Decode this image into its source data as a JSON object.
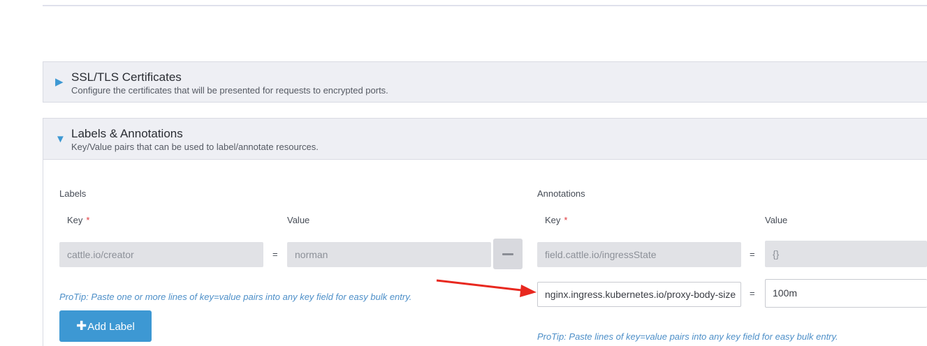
{
  "ssl": {
    "title": "SSL/TLS Certificates",
    "description": "Configure the certificates that will be presented for requests to encrypted ports."
  },
  "labels_section": {
    "title": "Labels & Annotations",
    "description": "Key/Value pairs that can be used to label/annotate resources."
  },
  "labels": {
    "heading": "Labels",
    "key_header": "Key",
    "value_header": "Value",
    "required_mark": "*",
    "rows": [
      {
        "key": "cattle.io/creator",
        "value": "norman"
      }
    ],
    "equals": "=",
    "protip": "ProTip: Paste one or more lines of key=value pairs into any key field for easy bulk entry.",
    "add_button": "Add Label",
    "add_icon": "plus-icon",
    "remove_icon": "minus-icon"
  },
  "annotations": {
    "heading": "Annotations",
    "key_header": "Key",
    "value_header": "Value",
    "required_mark": "*",
    "rows": [
      {
        "key": "field.cattle.io/ingressState",
        "value": "{}"
      },
      {
        "key": "nginx.ingress.kubernetes.io/proxy-body-size",
        "value": "100m"
      }
    ],
    "equals": "=",
    "protip": "ProTip: Paste lines of key=value pairs into any key field for easy bulk entry."
  },
  "colors": {
    "accent": "#3d98d3",
    "arrow": "#e8281f",
    "required": "#e0393e"
  }
}
